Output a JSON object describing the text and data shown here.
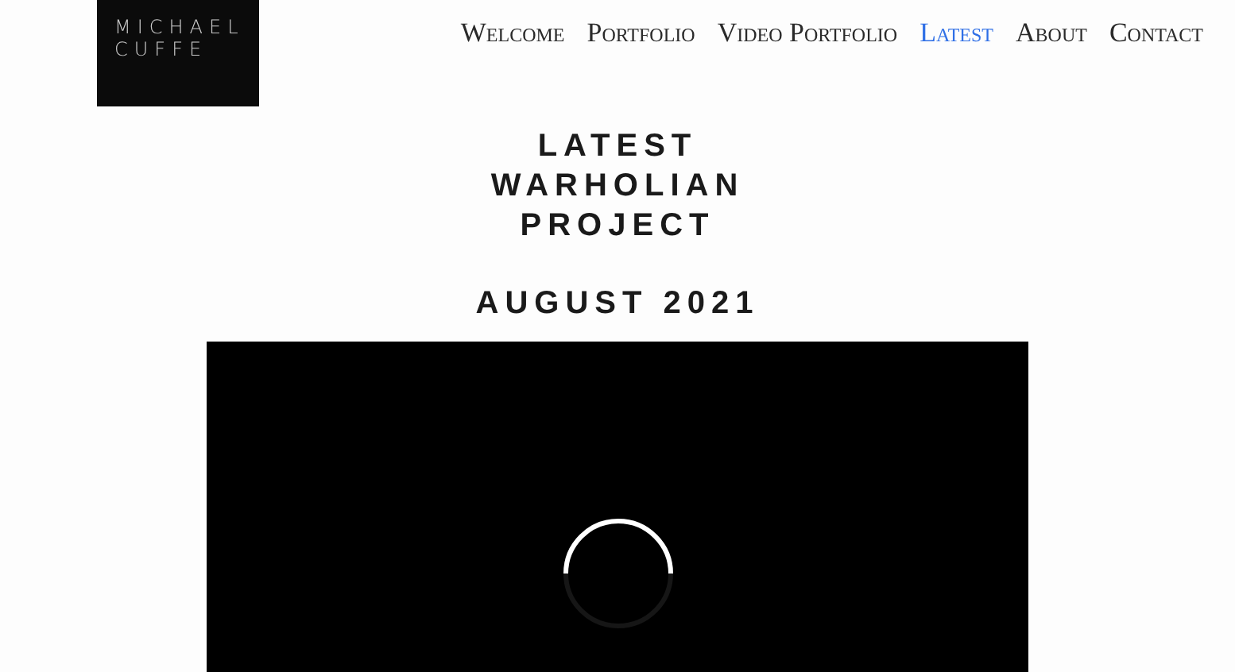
{
  "logo": {
    "lines": [
      "MICHAEL",
      "CUFFE"
    ]
  },
  "nav": [
    {
      "label": "Welcome",
      "selected": false
    },
    {
      "label": "Portfolio",
      "selected": false
    },
    {
      "label": "Video Portfolio",
      "selected": false
    },
    {
      "label": "Latest",
      "selected": true
    },
    {
      "label": "About",
      "selected": false
    },
    {
      "label": "Contact",
      "selected": false
    }
  ],
  "heading": [
    "LATEST",
    "WARHOLIAN",
    "PROJECT"
  ],
  "date": "AUGUST 2021",
  "video": {
    "loading": true
  }
}
